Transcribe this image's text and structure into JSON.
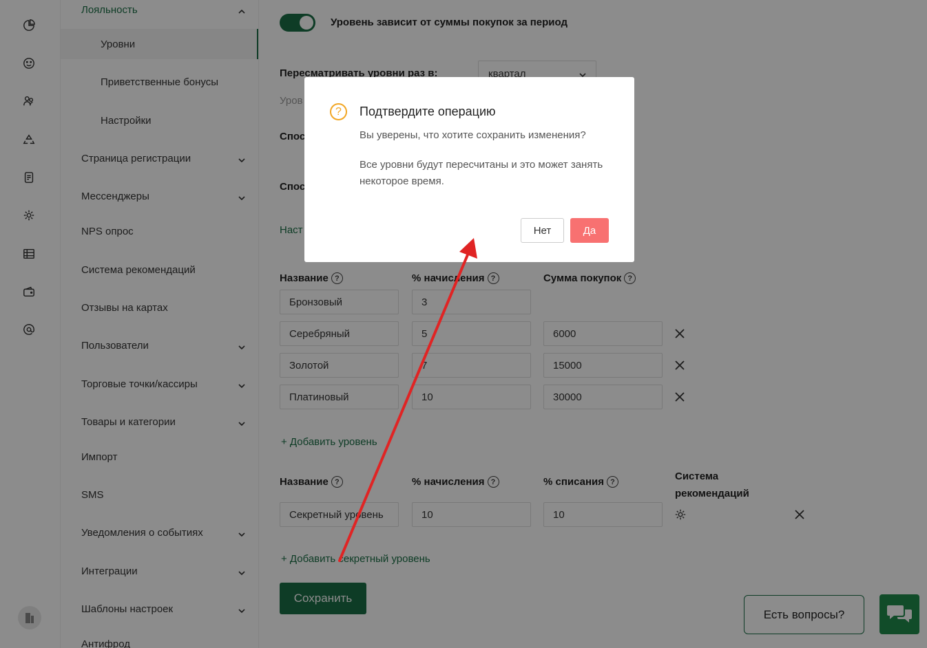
{
  "sidebar": {
    "items": [
      {
        "label": "Лояльность",
        "type": "parent-open"
      },
      {
        "label": "Уровни",
        "type": "sub-active"
      },
      {
        "label": "Приветственные бонусы",
        "type": "sub"
      },
      {
        "label": "Настройки",
        "type": "sub"
      },
      {
        "label": "Страница регистрации",
        "type": "parent"
      },
      {
        "label": "Мессенджеры",
        "type": "parent"
      },
      {
        "label": "NPS опрос",
        "type": "item"
      },
      {
        "label": "Система рекомендаций",
        "type": "item"
      },
      {
        "label": "Отзывы на картах",
        "type": "item"
      },
      {
        "label": "Пользователи",
        "type": "parent"
      },
      {
        "label": "Торговые точки/кассиры",
        "type": "parent"
      },
      {
        "label": "Товары и категории",
        "type": "parent"
      },
      {
        "label": "Импорт",
        "type": "item"
      },
      {
        "label": "SMS",
        "type": "item"
      },
      {
        "label": "Уведомления о событиях",
        "type": "parent"
      },
      {
        "label": "Интеграции",
        "type": "parent"
      },
      {
        "label": "Шаблоны настроек",
        "type": "parent"
      },
      {
        "label": "Антифрод",
        "type": "item"
      }
    ]
  },
  "main": {
    "toggle_label": "Уровень зависит от суммы покупок за период",
    "review_label": "Пересматривать уровни раз в:",
    "review_value": "квартал",
    "partial_muted": "Уров",
    "partial_label_1": "Спос",
    "partial_label_2": "Спос",
    "partial_link": "Наст",
    "levels_table": {
      "headers": [
        "Название",
        "% начисления",
        "Сумма покупок"
      ],
      "rows": [
        {
          "name": "Бронзовый",
          "percent": "3",
          "sum": ""
        },
        {
          "name": "Серебряный",
          "percent": "5",
          "sum": "6000"
        },
        {
          "name": "Золотой",
          "percent": "7",
          "sum": "15000"
        },
        {
          "name": "Платиновый",
          "percent": "10",
          "sum": "30000"
        }
      ]
    },
    "add_level": "+ Добавить уровень",
    "secret_table": {
      "headers": [
        "Название",
        "% начисления",
        "% списания",
        "Система рекомендаций"
      ],
      "rows": [
        {
          "name": "Секретный уровень",
          "percent": "10",
          "writeoff": "10"
        }
      ]
    },
    "add_secret_level": "+ Добавить секретный уровень",
    "save_label": "Сохранить",
    "help_label": "Есть вопросы?"
  },
  "modal": {
    "title": "Подтвердите операцию",
    "text1": "Вы уверены, что хотите сохранить изменения?",
    "text2": "Все уровни будут пересчитаны и это может занять некоторое время.",
    "no_label": "Нет",
    "yes_label": "Да",
    "icon": "question-circle-icon"
  },
  "colors": {
    "brand": "#1b6e45",
    "confirm": "#f87171",
    "warning": "#f2a623",
    "annotation_arrow": "#e02424"
  }
}
